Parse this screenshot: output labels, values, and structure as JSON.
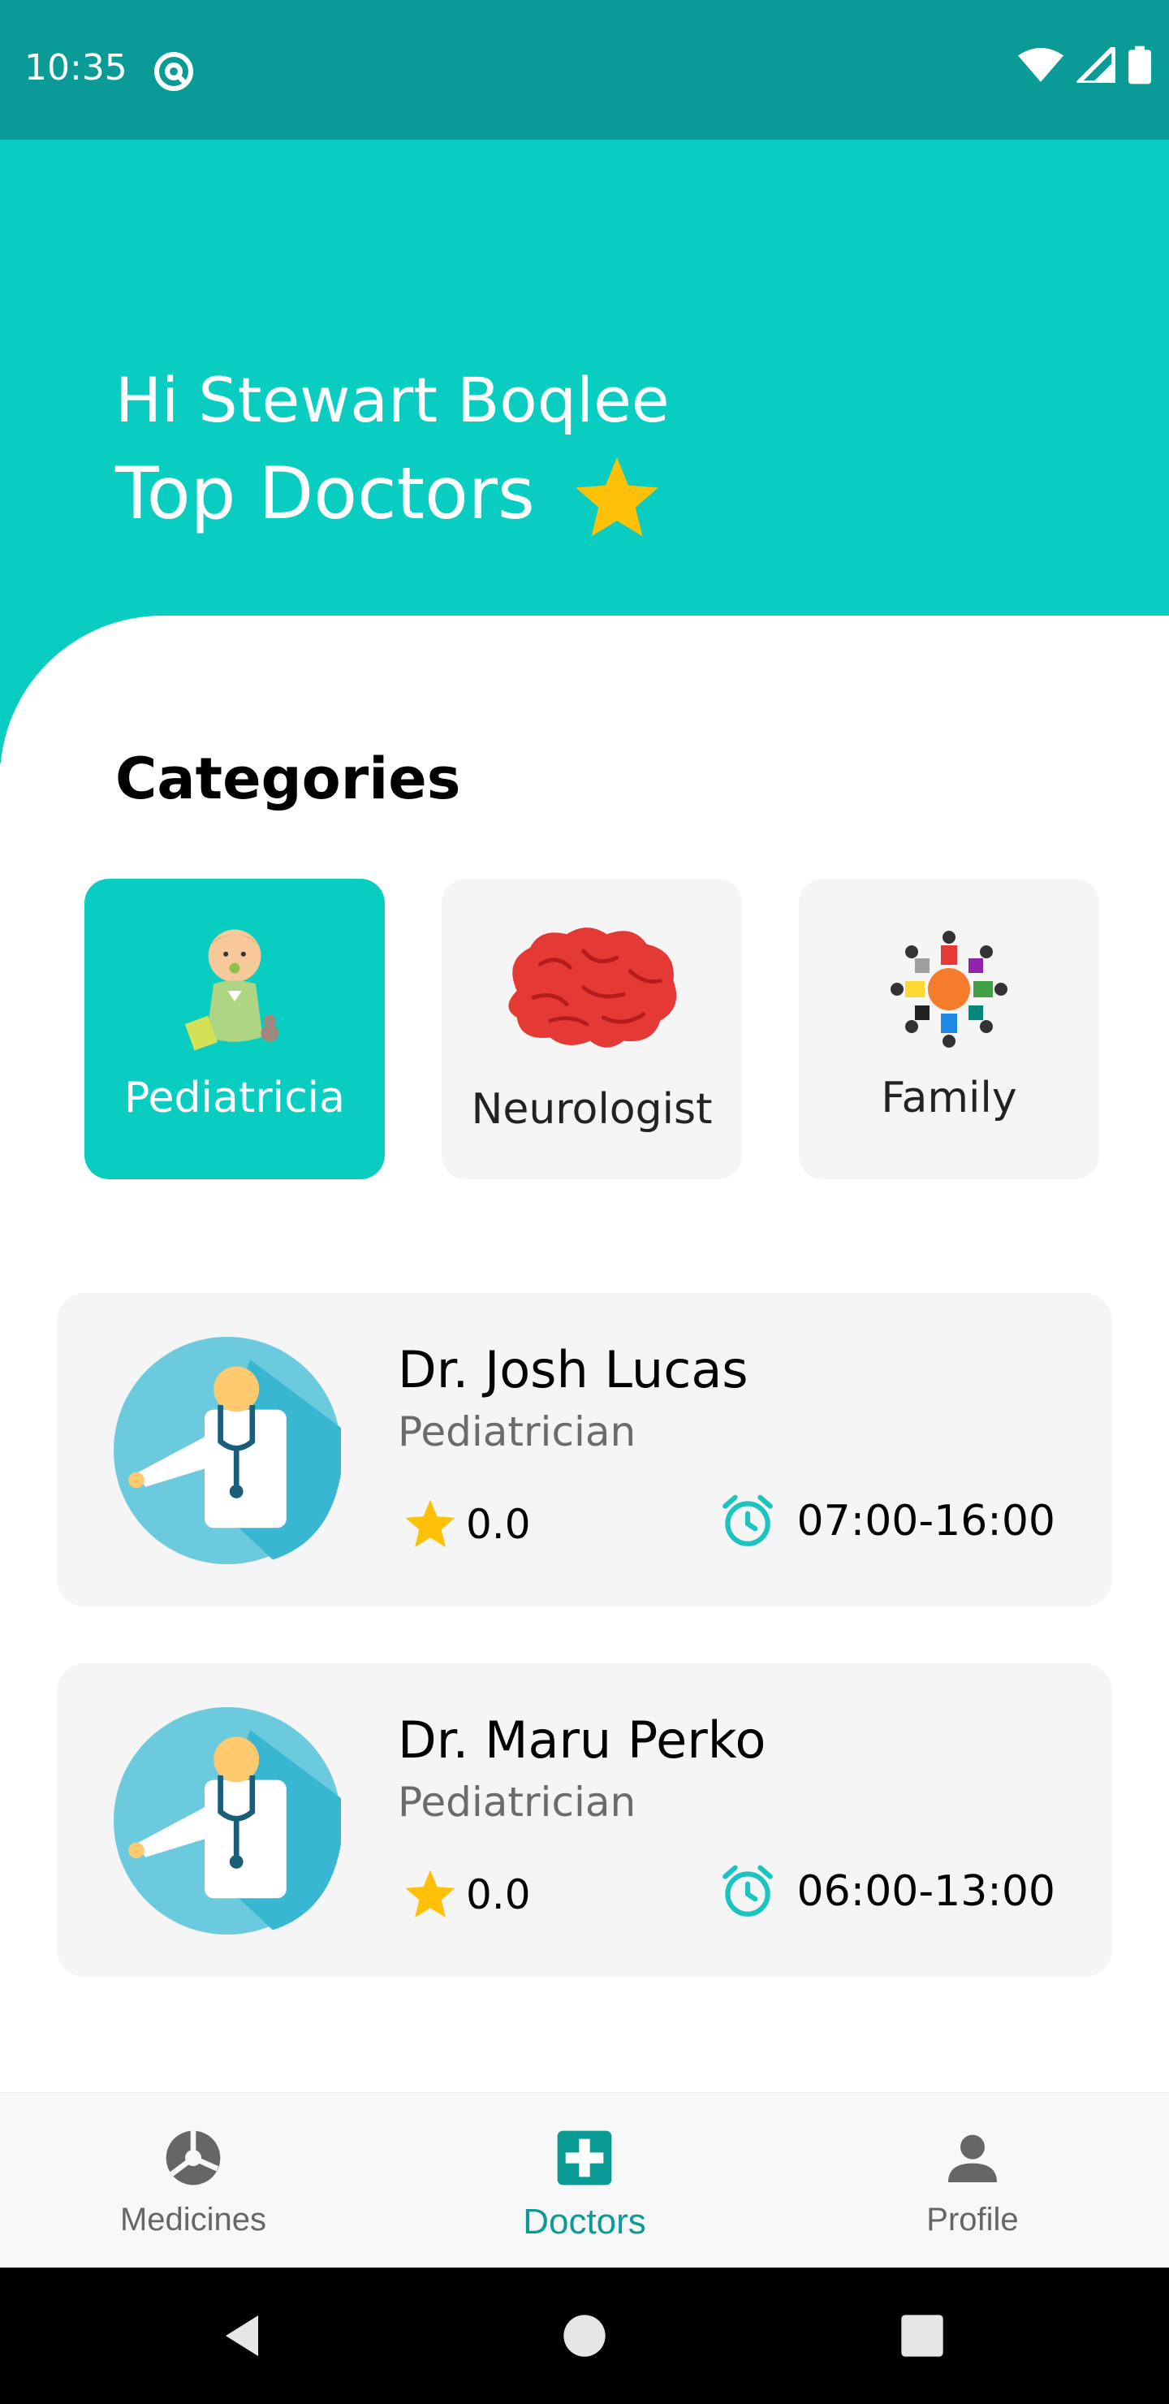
{
  "status_bar": {
    "time": "10:35",
    "icons": [
      "at-sign-icon",
      "wifi-icon",
      "signal-icon",
      "battery-icon"
    ]
  },
  "header": {
    "greeting": "Hi Stewart Boqlee",
    "title": "Top Doctors",
    "title_icon": "star-icon",
    "background_color": "#0acdc2"
  },
  "categories": {
    "heading": "Categories",
    "items": [
      {
        "label": "Pediatricia",
        "icon": "baby-icon",
        "selected": true
      },
      {
        "label": "Neurologist",
        "icon": "brain-icon",
        "selected": false
      },
      {
        "label": "Family",
        "icon": "family-circle-icon",
        "selected": false
      }
    ]
  },
  "doctors": [
    {
      "name": "Dr. Josh Lucas",
      "specialty": "Pediatrician",
      "rating": "0.0",
      "hours": "07:00-16:00"
    },
    {
      "name": "Dr. Maru Perko",
      "specialty": "Pediatrician",
      "rating": "0.0",
      "hours": "06:00-13:00"
    }
  ],
  "bottom_nav": {
    "items": [
      {
        "label": "Medicines",
        "icon": "pie-chart-icon",
        "active": false
      },
      {
        "label": "Doctors",
        "icon": "medical-cross-icon",
        "active": true
      },
      {
        "label": "Profile",
        "icon": "person-icon",
        "active": false
      }
    ]
  },
  "colors": {
    "accent": "#0acdc2",
    "status_bar": "#0a9b96",
    "star": "#ffc107",
    "card_bg": "#f5f5f5"
  }
}
